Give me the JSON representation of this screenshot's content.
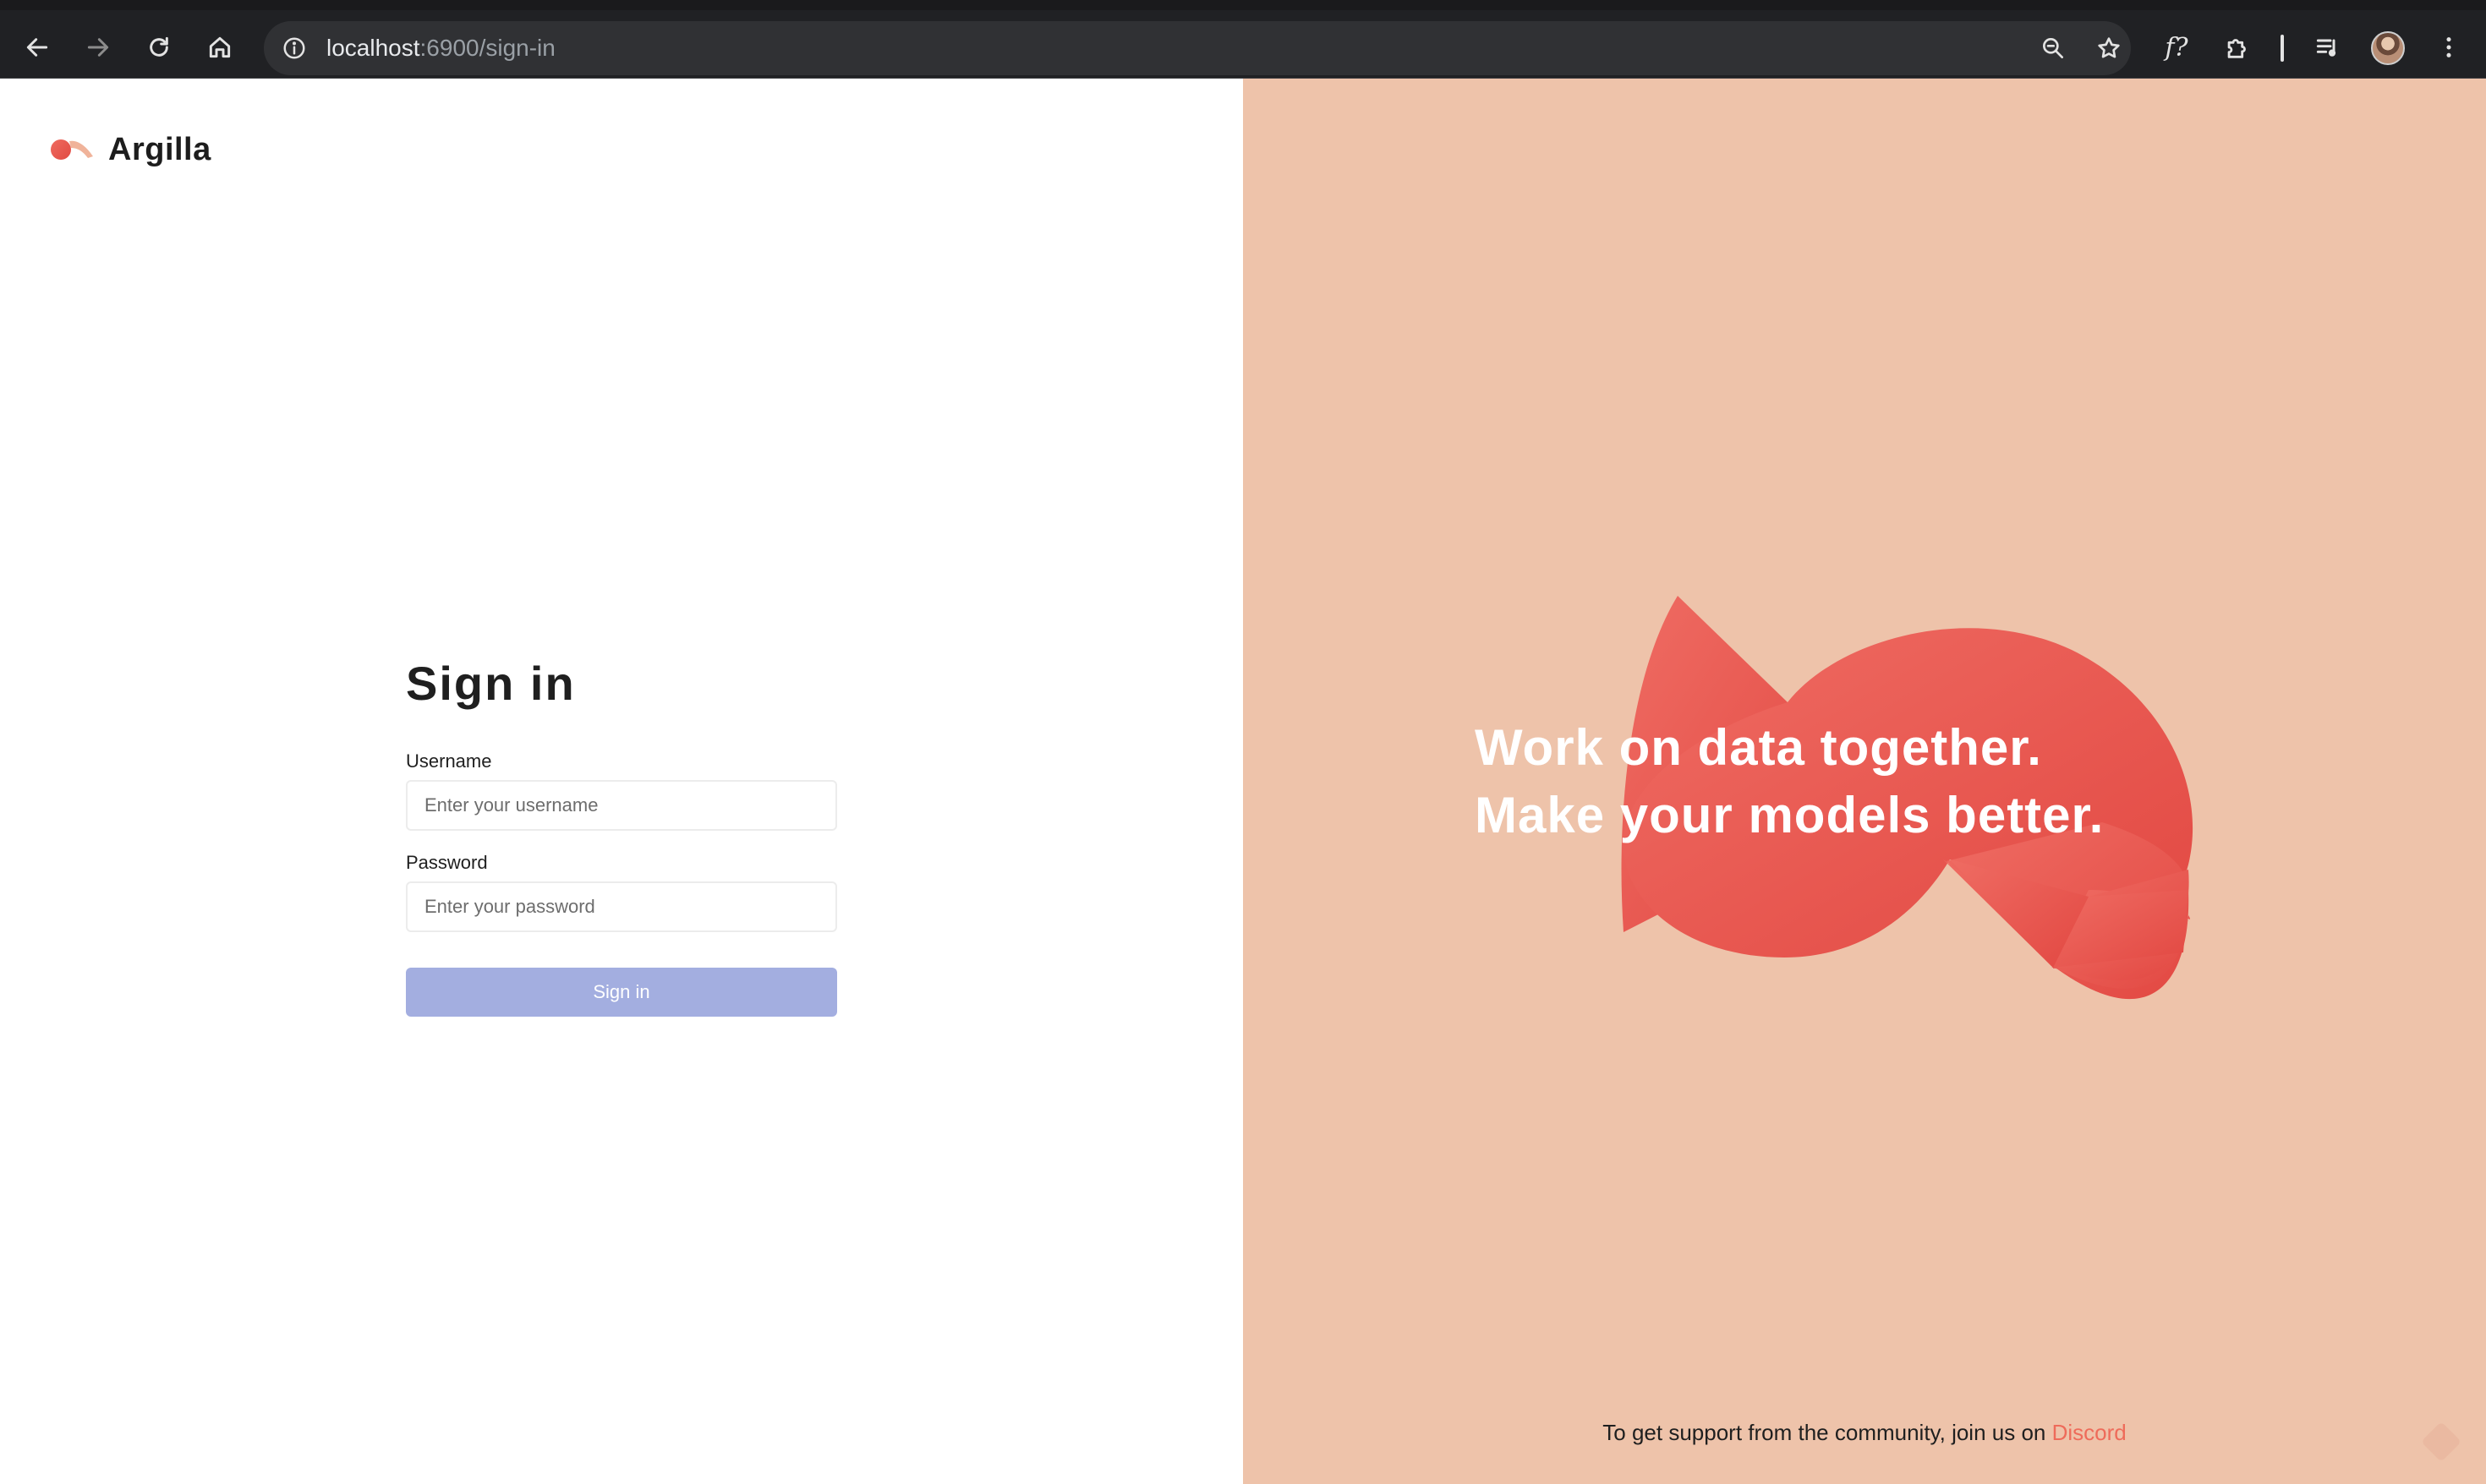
{
  "browser": {
    "url_host": "localhost",
    "url_path": ":6900/sign-in",
    "icons": {
      "back": "back-arrow-icon",
      "forward": "forward-arrow-icon",
      "reload": "reload-icon",
      "home": "home-icon",
      "site_info": "info-icon",
      "zoom": "zoom-icon",
      "bookmark": "star-icon",
      "function": "function-icon",
      "extensions": "puzzle-icon",
      "media": "media-queue-icon",
      "profile": "avatar",
      "menu": "kebab-menu-icon"
    },
    "function_label": "f?"
  },
  "brand": {
    "name": "Argilla"
  },
  "signin": {
    "title": "Sign in",
    "username_label": "Username",
    "username_placeholder": "Enter your username",
    "password_label": "Password",
    "password_placeholder": "Enter your password",
    "submit_label": "Sign in"
  },
  "hero": {
    "line1": "Work on data together.",
    "line2": "Make your models better."
  },
  "footer": {
    "support_text": "To get support from the community, join us on ",
    "support_link": "Discord"
  },
  "colors": {
    "hero_background": "#eec3aa",
    "accent_shape": "#e8564c",
    "submit_disabled": "#a3aee0",
    "link": "#ee6b5a"
  }
}
